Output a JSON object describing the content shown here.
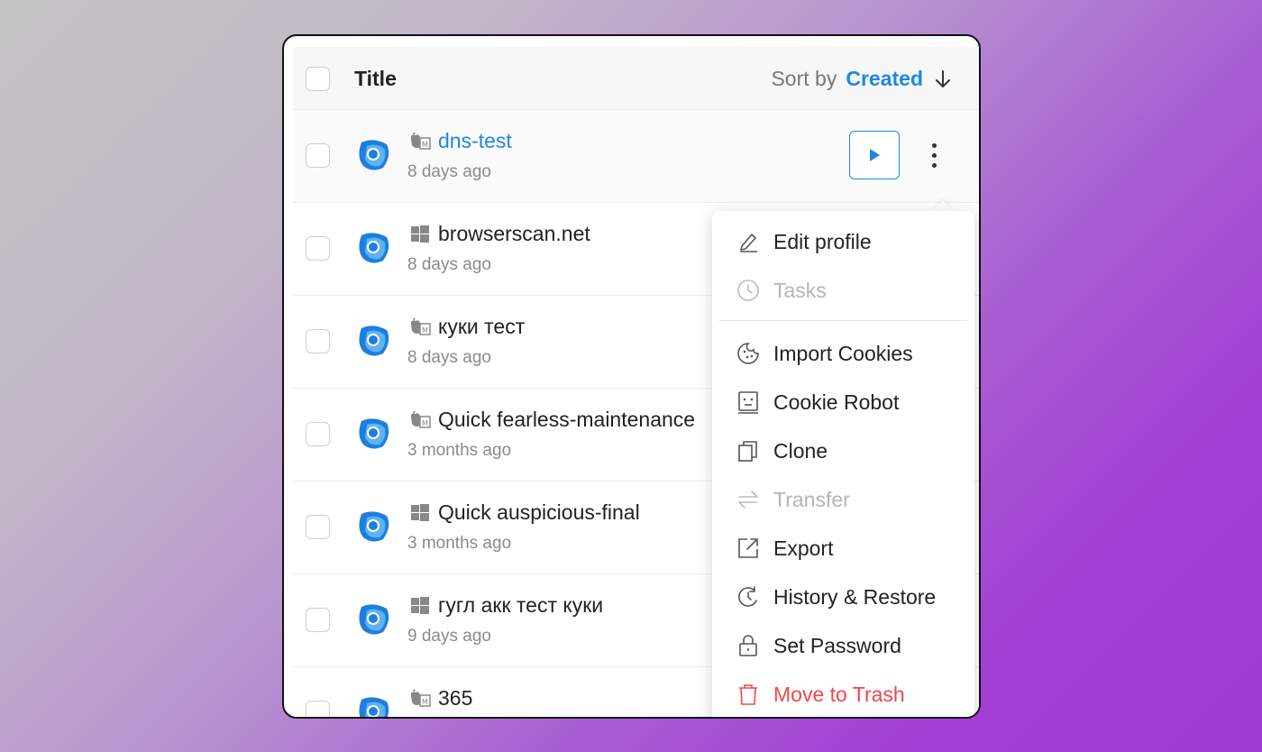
{
  "header": {
    "title_label": "Title",
    "sort_prefix": "Sort by",
    "sort_value": "Created"
  },
  "rows": [
    {
      "name": "dns-test",
      "date": "8 days ago",
      "os": "macos-icon"
    },
    {
      "name": "browserscan.net",
      "date": "8 days ago",
      "os": "windows-icon"
    },
    {
      "name": "куки тест",
      "date": "8 days ago",
      "os": "macos-icon"
    },
    {
      "name": "Quick fearless-maintenance",
      "date": "3 months ago",
      "os": "macos-icon"
    },
    {
      "name": "Quick auspicious-final",
      "date": "3 months ago",
      "os": "windows-icon"
    },
    {
      "name": "гугл акк тест куки",
      "date": "9 days ago",
      "os": "windows-icon"
    },
    {
      "name": "365",
      "date": "",
      "os": "macos-icon"
    }
  ],
  "menu": {
    "items": [
      {
        "label": "Edit profile",
        "icon": "pencil-icon"
      },
      {
        "label": "Tasks",
        "icon": "clock-icon"
      },
      {
        "label": "Import Cookies",
        "icon": "cookie-icon"
      },
      {
        "label": "Cookie Robot",
        "icon": "robot-icon"
      },
      {
        "label": "Clone",
        "icon": "copy-icon"
      },
      {
        "label": "Transfer",
        "icon": "transfer-icon"
      },
      {
        "label": "Export",
        "icon": "export-icon"
      },
      {
        "label": "History & Restore",
        "icon": "history-icon"
      },
      {
        "label": "Set Password",
        "icon": "lock-icon"
      },
      {
        "label": "Move to Trash",
        "icon": "trash-icon"
      }
    ]
  },
  "colors": {
    "accent": "#1e88e5",
    "danger": "#f0464a",
    "disabled": "#b5b5b5"
  }
}
